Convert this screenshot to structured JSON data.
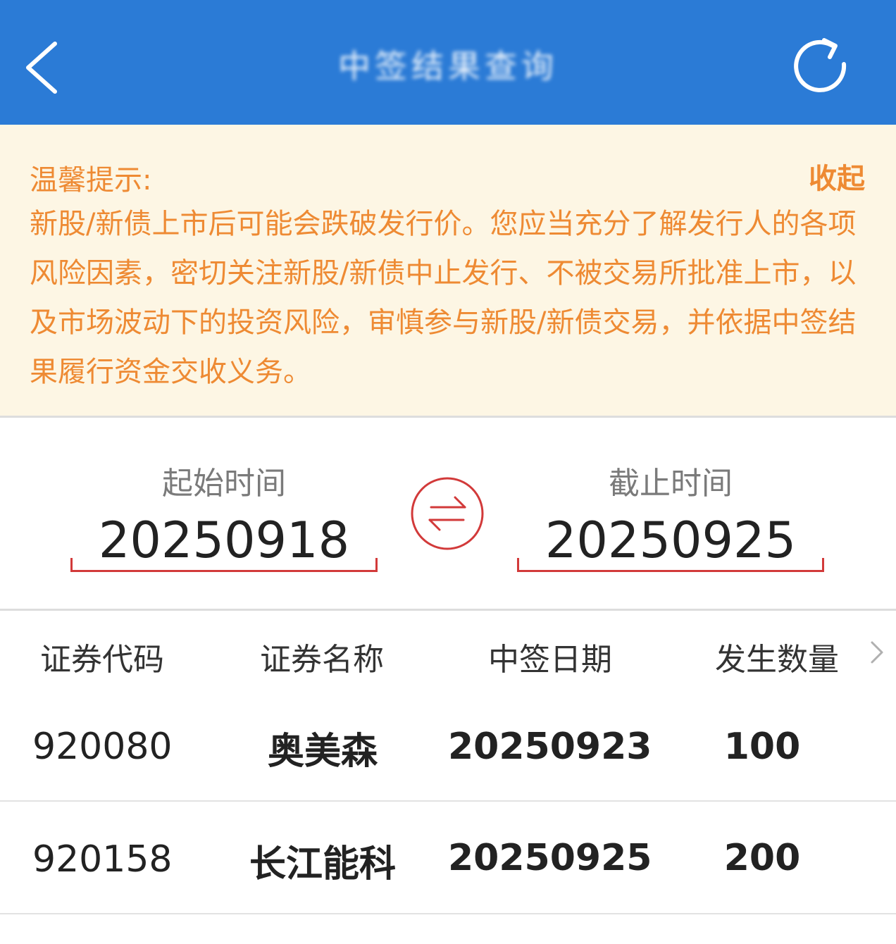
{
  "header": {
    "title": "中签结果查询",
    "back_icon": "chevron-left-icon",
    "refresh_icon": "refresh-icon",
    "background_color": "#2b7bd6"
  },
  "tip": {
    "label": "温馨提示:",
    "collapse_label": "收起",
    "text": "新股/新债上市后可能会跌破发行价。您应当充分了解发行人的各项风险因素，密切关注新股/新债中止发行、不被交易所批准上市，以及市场波动下的投资风险，审慎参与新股/新债交易，并依据中签结果履行资金交收义务。",
    "text_color": "#ee8a33",
    "background_color": "#fdf6e4"
  },
  "date_range": {
    "start_label": "起始时间",
    "start_value": "20250918",
    "end_label": "截止时间",
    "end_value": "20250925",
    "swap_icon": "swap-arrows-icon",
    "accent_color": "#d23a3a"
  },
  "table": {
    "columns": [
      "证券代码",
      "证券名称",
      "中签日期",
      "发生数量"
    ],
    "more_icon": "chevron-right-icon",
    "rows": [
      {
        "code": "920080",
        "name": "奥美森",
        "date": "20250923",
        "quantity": "100"
      },
      {
        "code": "920158",
        "name": "长江能科",
        "date": "20250925",
        "quantity": "200"
      }
    ]
  }
}
